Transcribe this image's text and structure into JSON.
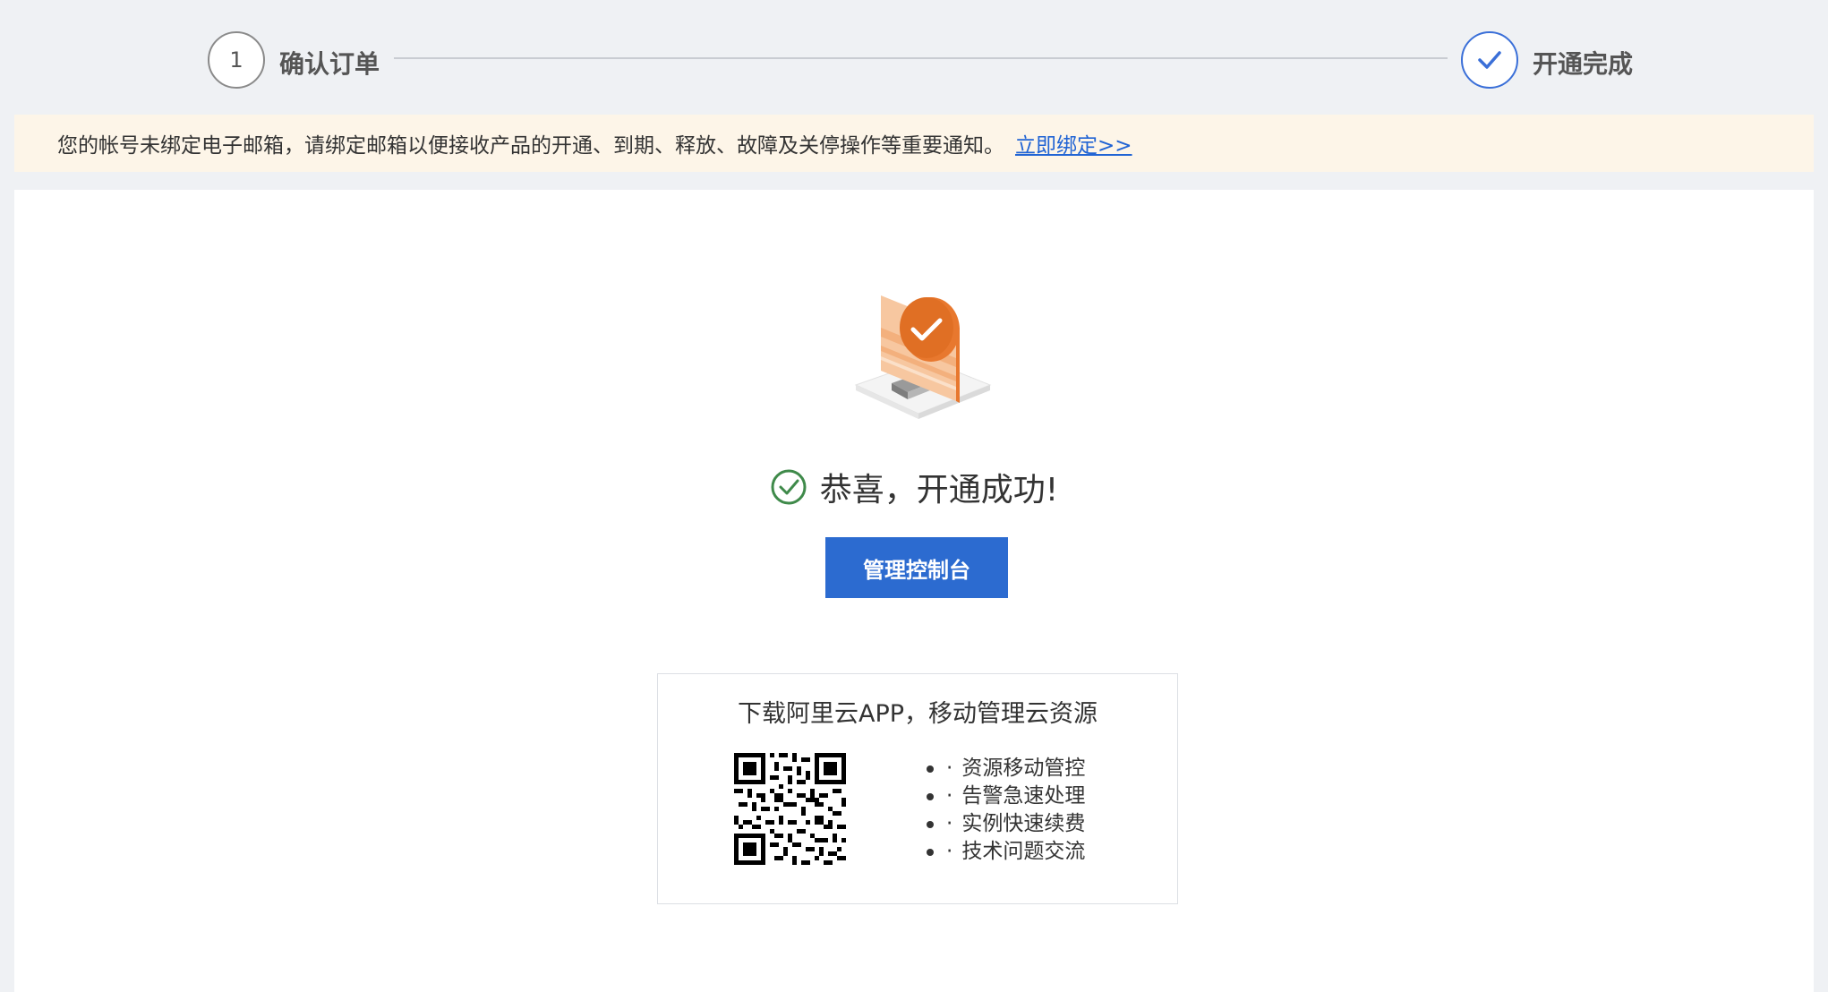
{
  "steps": [
    {
      "number": "1",
      "label": "确认订单"
    },
    {
      "label": "开通完成"
    }
  ],
  "notice": {
    "text": "您的帐号未绑定电子邮箱，请绑定邮箱以便接收产品的开通、到期、释放、故障及关停操作等重要通知。",
    "link": "立即绑定>>"
  },
  "success": {
    "message": "恭喜，开通成功!"
  },
  "console_button": "管理控制台",
  "app_promo": {
    "title": "下载阿里云APP，移动管理云资源",
    "features": [
      "资源移动管控",
      "告警急速处理",
      "实例快速续费",
      "技术问题交流"
    ],
    "feature_prefix": "·"
  },
  "colors": {
    "accent": "#2c6bd0",
    "success": "#3f8a4a",
    "notice_bg": "#fdf5e8",
    "illustration": "#e8782e"
  },
  "icons": [
    "check-icon",
    "success-check-icon",
    "qr-code",
    "success-illustration"
  ]
}
